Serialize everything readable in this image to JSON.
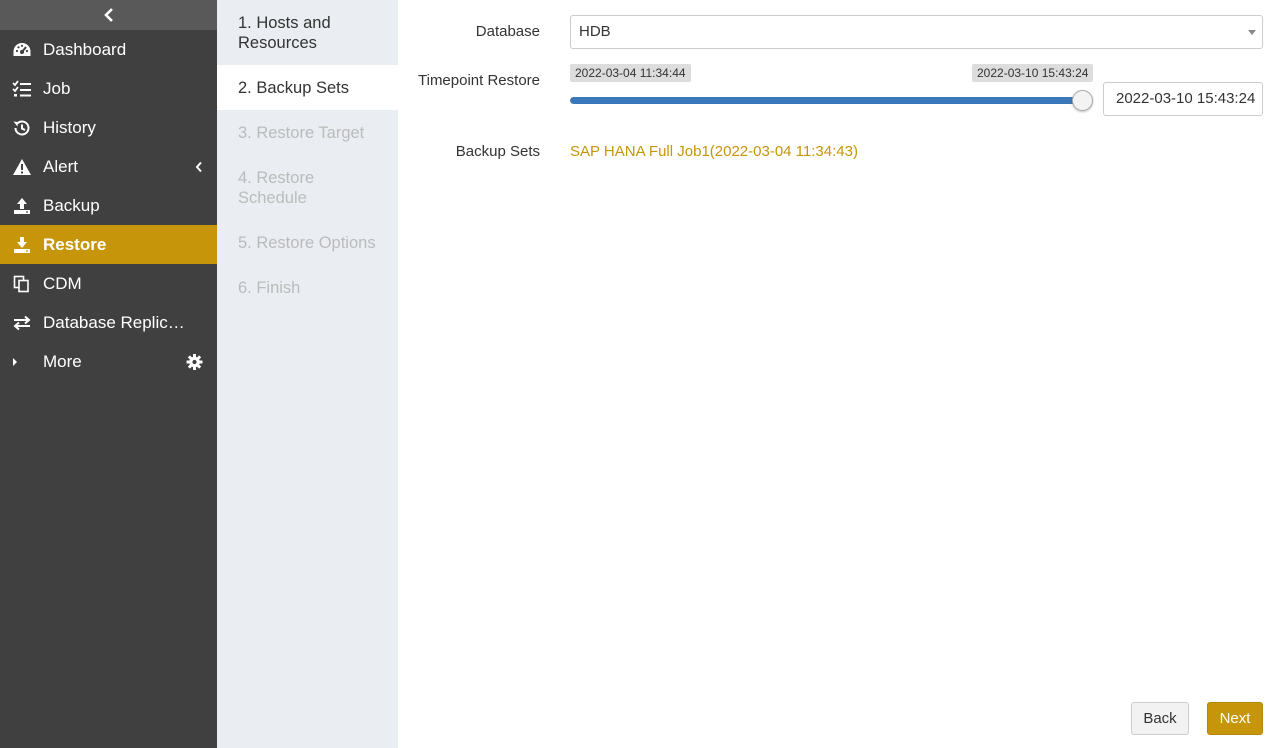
{
  "sidebar": {
    "items": [
      {
        "label": "Dashboard",
        "icon": "dashboard-icon"
      },
      {
        "label": "Job",
        "icon": "job-list-icon"
      },
      {
        "label": "History",
        "icon": "history-icon"
      },
      {
        "label": "Alert",
        "icon": "alert-icon"
      },
      {
        "label": "Backup",
        "icon": "backup-upload-icon"
      },
      {
        "label": "Restore",
        "icon": "restore-download-icon"
      },
      {
        "label": "CDM",
        "icon": "cdm-copy-icon"
      },
      {
        "label": "Database Replica…",
        "icon": "replication-arrows-icon"
      },
      {
        "label": "More",
        "icon": "caret-right-icon"
      }
    ],
    "active_item": "Restore"
  },
  "steps": [
    {
      "label": "1. Hosts and Resources",
      "state": "done"
    },
    {
      "label": "2. Backup Sets",
      "state": "active"
    },
    {
      "label": "3. Restore Target",
      "state": "disabled"
    },
    {
      "label": "4. Restore Schedule",
      "state": "disabled"
    },
    {
      "label": "5. Restore Options",
      "state": "disabled"
    },
    {
      "label": "6. Finish",
      "state": "disabled"
    }
  ],
  "form": {
    "database_label": "Database",
    "database_value": "HDB",
    "timepoint_label": "Timepoint Restore",
    "timepoint_min": "2022-03-04 11:34:44",
    "timepoint_max": "2022-03-10 15:43:24",
    "timepoint_value": "2022-03-10 15:43:24",
    "timepoint_fraction": 1.0,
    "backup_sets_label": "Backup Sets",
    "backup_sets_value": "SAP HANA Full Job1(2022-03-04 11:34:43)"
  },
  "buttons": {
    "back": "Back",
    "next": "Next"
  },
  "colors": {
    "accent": "#c7950a",
    "sidebar_bg": "#404040",
    "slider_fill": "#3a78b9"
  }
}
